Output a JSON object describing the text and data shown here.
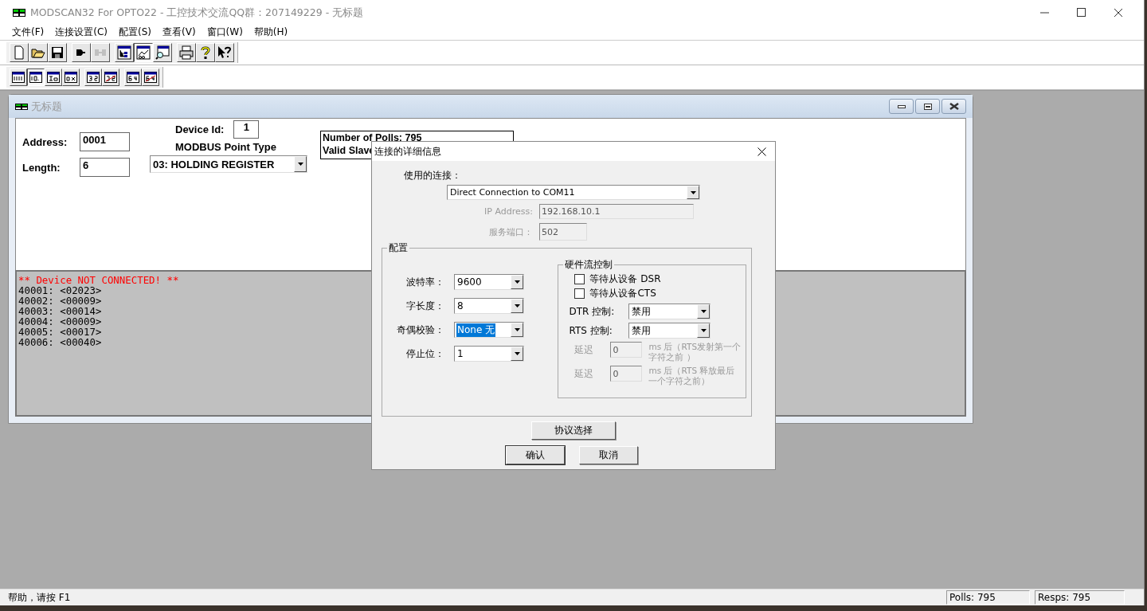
{
  "window": {
    "title": "MODSCAN32 For OPTO22 - 工控技术交流QQ群：207149229 - 无标题"
  },
  "menu": [
    "文件(F)",
    "连接设置(C)",
    "配置(S)",
    "查看(V)",
    "窗口(W)",
    "帮助(H)"
  ],
  "toolbar_1": [
    [
      {
        "kind": "new",
        "pressed": false,
        "disabled": false
      },
      {
        "kind": "open",
        "pressed": false,
        "disabled": false
      },
      {
        "kind": "save",
        "pressed": false,
        "disabled": false
      }
    ],
    [
      {
        "kind": "connect",
        "pressed": false,
        "disabled": false
      },
      {
        "kind": "disconnect",
        "pressed": false,
        "disabled": true
      }
    ],
    [
      {
        "kind": "tree",
        "pressed": false,
        "disabled": false
      },
      {
        "kind": "chart",
        "pressed": true,
        "disabled": false
      },
      {
        "kind": "inspect",
        "pressed": false,
        "disabled": false
      }
    ],
    [
      {
        "kind": "print",
        "pressed": false,
        "disabled": false
      },
      {
        "kind": "help",
        "pressed": false,
        "disabled": false
      },
      {
        "kind": "context-help",
        "pressed": false,
        "disabled": false
      }
    ]
  ],
  "toolbar_2": [
    [
      {
        "kind": "binary",
        "pressed": false
      },
      {
        "kind": "decimal",
        "pressed": true
      },
      {
        "kind": "integer",
        "pressed": false
      },
      {
        "kind": "hex",
        "pressed": false
      }
    ],
    [
      {
        "kind": "float",
        "pressed": false
      },
      {
        "kind": "float-swapped",
        "pressed": false
      }
    ],
    [
      {
        "kind": "double",
        "pressed": false
      },
      {
        "kind": "double-swapped",
        "pressed": false
      }
    ]
  ],
  "child": {
    "title": "无标题",
    "address_label": "Address:",
    "address": "0001",
    "length_label": "Length:",
    "length": "6",
    "device_id_label": "Device Id:",
    "device_id": "1",
    "point_type_label": "MODBUS Point Type",
    "point_type": "03: HOLDING REGISTER",
    "stats": [
      "Number of Polls: 795",
      "Valid Slave"
    ],
    "status_line": "** Device NOT CONNECTED! **",
    "registers": [
      "40001: <02023>",
      "40002: <00009>",
      "40003: <00014>",
      "40004: <00009>",
      "40005: <00017>",
      "40006: <00040>"
    ]
  },
  "dialog": {
    "title": "连接的详细信息",
    "connection_label": "使用的连接：",
    "connection": "Direct Connection to COM11",
    "ip": {
      "label": "IP Address:",
      "value": "192.168.10.1",
      "disabled": true
    },
    "port": {
      "label": "服务端口：",
      "value": "502",
      "disabled": true
    },
    "config_group": "配置",
    "serial_fields": [
      {
        "label": "波特率：",
        "value": "9600",
        "selected": false
      },
      {
        "label": "字长度：",
        "value": "8",
        "selected": false
      },
      {
        "label": "奇偶校验：",
        "value": "None 无",
        "selected": true
      },
      {
        "label": "停止位：",
        "value": "1",
        "selected": false
      }
    ],
    "flow_group": "硬件流控制",
    "checks": [
      {
        "label": "等待从设备 DSR",
        "checked": false
      },
      {
        "label": "等待从设备CTS",
        "checked": false
      }
    ],
    "controls": [
      {
        "label": "DTR 控制:",
        "value": "禁用"
      },
      {
        "label": "RTS 控制:",
        "value": "禁用"
      }
    ],
    "delays": [
      {
        "label": "延迟",
        "value": "0",
        "note": "ms 后（RTS发射第一个字符之前 ）",
        "disabled": true
      },
      {
        "label": "延迟",
        "value": "0",
        "note": "ms 后（RTS 释放最后一个字符之前）",
        "disabled": true
      }
    ],
    "protocol_button": "协议选择",
    "ok": "确认",
    "cancel": "取消"
  },
  "status_bar": {
    "help": "帮助，请按 F1",
    "polls": "Polls: 795",
    "resps": "Resps: 795"
  }
}
